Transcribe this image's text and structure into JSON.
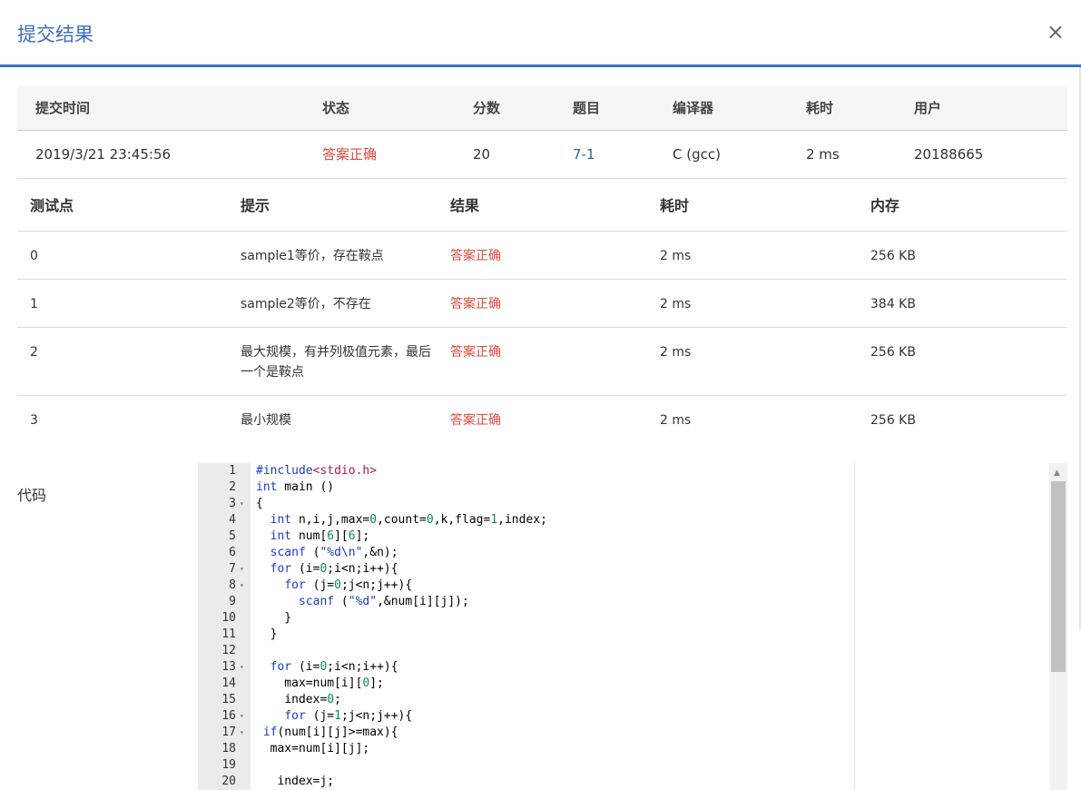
{
  "modal": {
    "title": "提交结果",
    "close_glyph": "×"
  },
  "submission": {
    "headers": [
      "提交时间",
      "状态",
      "分数",
      "题目",
      "编译器",
      "耗时",
      "用户"
    ],
    "row": {
      "time": "2019/3/21 23:45:56",
      "status": "答案正确",
      "score": "20",
      "problem": "7-1",
      "compiler": "C (gcc)",
      "elapsed": "2 ms",
      "user": "20188665"
    }
  },
  "tests": {
    "headers": [
      "测试点",
      "提示",
      "结果",
      "耗时",
      "内存"
    ],
    "rows": [
      {
        "id": "0",
        "hint": "sample1等价，存在鞍点",
        "result": "答案正确",
        "time": "2 ms",
        "memory": "256 KB"
      },
      {
        "id": "1",
        "hint": "sample2等价，不存在",
        "result": "答案正确",
        "time": "2 ms",
        "memory": "384 KB"
      },
      {
        "id": "2",
        "hint": "最大规模，有并列极值元素，最后一个是鞍点",
        "result": "答案正确",
        "time": "2 ms",
        "memory": "256 KB"
      },
      {
        "id": "3",
        "hint": "最小规模",
        "result": "答案正确",
        "time": "2 ms",
        "memory": "256 KB"
      }
    ]
  },
  "code": {
    "label": "代码",
    "lines": [
      {
        "n": "1",
        "fold": "",
        "text": "#include<stdio.h>"
      },
      {
        "n": "2",
        "fold": "",
        "text": "int main ()"
      },
      {
        "n": "3",
        "fold": "▾",
        "text": "{"
      },
      {
        "n": "4",
        "fold": "",
        "text": "  int n,i,j,max=0,count=0,k,flag=1,index;"
      },
      {
        "n": "5",
        "fold": "",
        "text": "  int num[6][6];"
      },
      {
        "n": "6",
        "fold": "",
        "text": "  scanf (\"%d\\n\",&n);"
      },
      {
        "n": "7",
        "fold": "▾",
        "text": "  for (i=0;i<n;i++){"
      },
      {
        "n": "8",
        "fold": "▾",
        "text": "    for (j=0;j<n;j++){"
      },
      {
        "n": "9",
        "fold": "",
        "text": "      scanf (\"%d\",&num[i][j]);"
      },
      {
        "n": "10",
        "fold": "",
        "text": "    }"
      },
      {
        "n": "11",
        "fold": "",
        "text": "  }"
      },
      {
        "n": "12",
        "fold": "",
        "text": ""
      },
      {
        "n": "13",
        "fold": "▾",
        "text": "  for (i=0;i<n;i++){"
      },
      {
        "n": "14",
        "fold": "",
        "text": "    max=num[i][0];"
      },
      {
        "n": "15",
        "fold": "",
        "text": "    index=0;"
      },
      {
        "n": "16",
        "fold": "▾",
        "text": "    for (j=1;j<n;j++){"
      },
      {
        "n": "17",
        "fold": "▾",
        "text": " if(num[i][j]>=max){"
      },
      {
        "n": "18",
        "fold": "",
        "text": "  max=num[i][j];"
      },
      {
        "n": "19",
        "fold": "",
        "text": ""
      },
      {
        "n": "20",
        "fold": "",
        "text": "   index=j;"
      }
    ]
  },
  "colors": {
    "accent": "#3f6ebf",
    "success_red": "#e0483c",
    "link": "#2f5f9c"
  }
}
